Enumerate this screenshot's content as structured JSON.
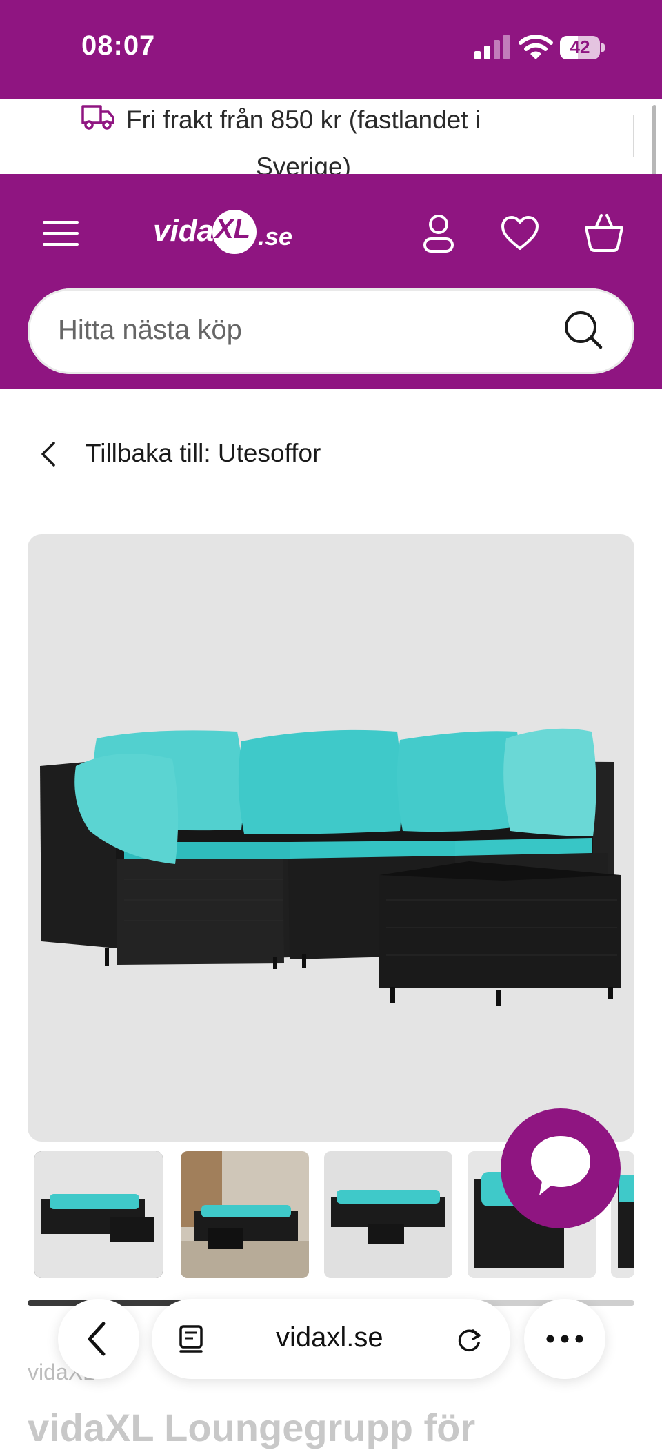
{
  "status_bar": {
    "time": "08:07",
    "battery_level": "42"
  },
  "promo": {
    "text": "Fri frakt från 850 kr (fastlandet i Sverige)"
  },
  "header": {
    "logo_main": "vida",
    "logo_xl": "XL",
    "logo_domain": ".se",
    "icons": [
      "menu-icon",
      "user-icon",
      "heart-icon",
      "cart-icon"
    ]
  },
  "search": {
    "placeholder": "Hitta nästa köp"
  },
  "breadcrumb": {
    "back_label": "Tillbaka till: Utesoffor"
  },
  "gallery": {
    "thumbnails": [
      "thumb-1",
      "thumb-2",
      "thumb-3",
      "thumb-4"
    ],
    "selected_index": 0
  },
  "product": {
    "brand": "vidaXL",
    "title": "vidaXL Loungegrupp för"
  },
  "browser": {
    "url": "vidaxl.se"
  },
  "colors": {
    "brand": "#8f1581",
    "cushion": "#3fc9c9",
    "rattan": "#1b1b1b"
  }
}
